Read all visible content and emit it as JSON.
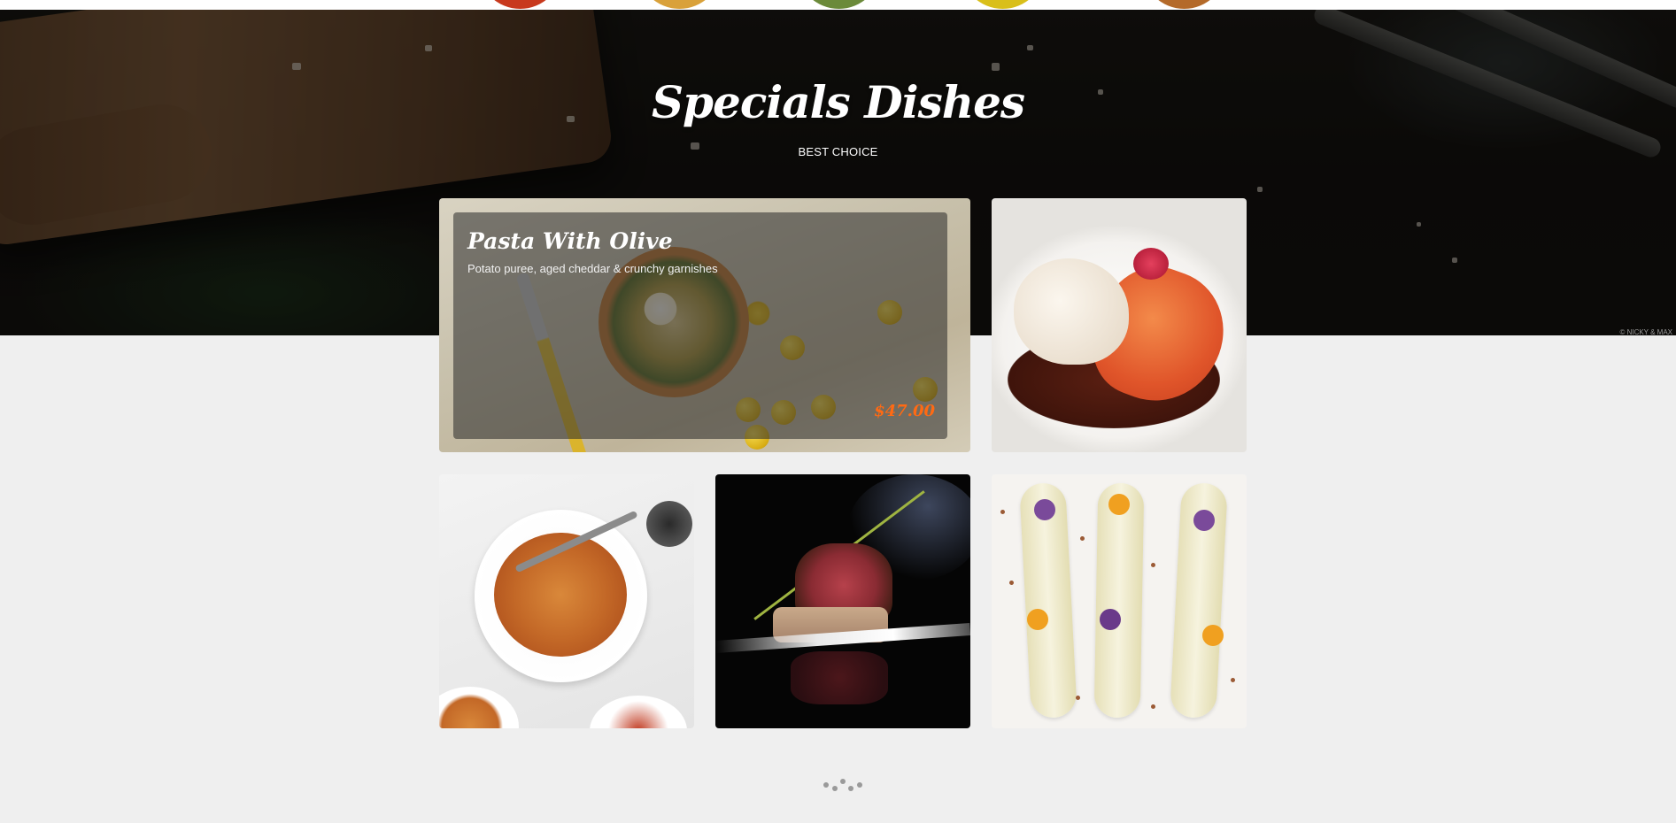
{
  "hero": {
    "title": "Specials Dishes",
    "subtitle": "BEST CHOICE",
    "photo_credit": "© NICKY & MAX"
  },
  "featured": {
    "name": "Pasta With Olive",
    "description": "Potato puree, aged cheddar & crunchy garnishes",
    "price": "$47.00"
  },
  "colors": {
    "accent_price": "#ff6a13",
    "page_background": "#efefef"
  },
  "icons": [
    "loading-dots-icon"
  ]
}
